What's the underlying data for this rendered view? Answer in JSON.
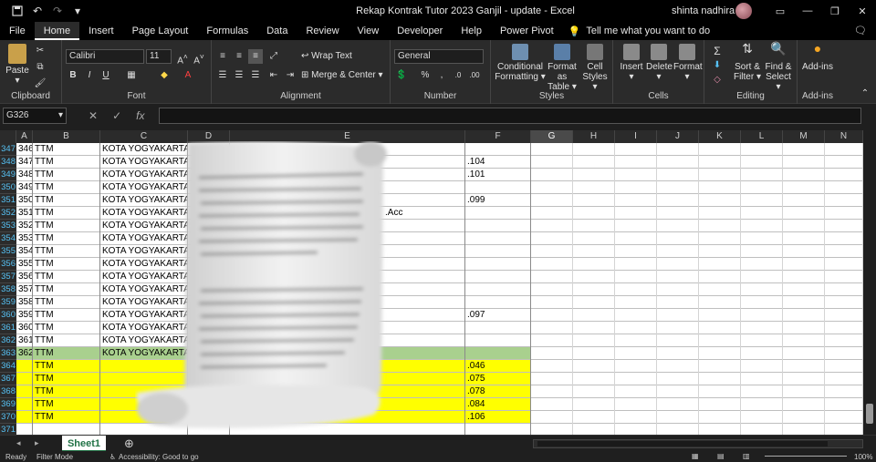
{
  "window": {
    "title": "Rekap Kontrak Tutor 2023 Ganjil - update  -  Excel",
    "user": "shinta nadhira"
  },
  "tabs": [
    "File",
    "Home",
    "Insert",
    "Page Layout",
    "Formulas",
    "Data",
    "Review",
    "View",
    "Developer",
    "Help",
    "Power Pivot"
  ],
  "tellme": "Tell me what you want to do",
  "ribbon": {
    "paste": "Paste",
    "font_name": "Calibri",
    "font_size": "11",
    "wrap_text": "Wrap Text",
    "merge_center": "Merge & Center",
    "number_format": "General",
    "conditional": "Conditional",
    "formatting": "Formatting",
    "format_as": "Format as",
    "table": "Table",
    "cell": "Cell",
    "styles_btn": "Styles",
    "insert": "Insert",
    "delete": "Delete",
    "format": "Format",
    "sort_filter": "Sort &",
    "filter": "Filter",
    "find_select": "Find &",
    "select": "Select",
    "addins": "Add-ins",
    "groups": {
      "clipboard": "Clipboard",
      "font": "Font",
      "alignment": "Alignment",
      "number": "Number",
      "styles": "Styles",
      "cells": "Cells",
      "editing": "Editing",
      "addins": "Add-ins"
    }
  },
  "formula_bar": {
    "name_box": "G326",
    "formula": ""
  },
  "columns": [
    "A",
    "B",
    "C",
    "D",
    "E",
    "F",
    "G",
    "H",
    "I",
    "J",
    "K",
    "L",
    "M",
    "N"
  ],
  "selected_column": "G",
  "rows": [
    {
      "row": "347",
      "a": "346",
      "b": "TTM",
      "c": "KOTA YOGYAKARTA",
      "e": "",
      "f": "",
      "style": "plain"
    },
    {
      "row": "348",
      "a": "347",
      "b": "TTM",
      "c": "KOTA YOGYAKARTA",
      "e": "",
      "f": ".104",
      "style": "plain"
    },
    {
      "row": "349",
      "a": "348",
      "b": "TTM",
      "c": "KOTA YOGYAKARTA",
      "e": "",
      "f": ".101",
      "style": "plain"
    },
    {
      "row": "350",
      "a": "349",
      "b": "TTM",
      "c": "KOTA YOGYAKARTA",
      "e": "",
      "f": "",
      "style": "plain"
    },
    {
      "row": "351",
      "a": "350",
      "b": "TTM",
      "c": "KOTA YOGYAKARTA",
      "e": "",
      "f": ".099",
      "style": "plain"
    },
    {
      "row": "352",
      "a": "351",
      "b": "TTM",
      "c": "KOTA YOGYAKARTA",
      "e": ".Acc",
      "f": "",
      "style": "plain"
    },
    {
      "row": "353",
      "a": "352",
      "b": "TTM",
      "c": "KOTA YOGYAKARTA",
      "e": "",
      "f": "",
      "style": "plain"
    },
    {
      "row": "354",
      "a": "353",
      "b": "TTM",
      "c": "KOTA YOGYAKARTA",
      "e": "",
      "f": "",
      "style": "plain"
    },
    {
      "row": "355",
      "a": "354",
      "b": "TTM",
      "c": "KOTA YOGYAKARTA",
      "e": "",
      "f": "",
      "style": "plain"
    },
    {
      "row": "356",
      "a": "355",
      "b": "TTM",
      "c": "KOTA YOGYAKARTA",
      "e": "",
      "f": "",
      "style": "plain"
    },
    {
      "row": "357",
      "a": "356",
      "b": "TTM",
      "c": "KOTA YOGYAKARTA",
      "e": "",
      "f": "",
      "style": "plain"
    },
    {
      "row": "358",
      "a": "357",
      "b": "TTM",
      "c": "KOTA YOGYAKARTA",
      "e": "",
      "f": "",
      "style": "plain"
    },
    {
      "row": "359",
      "a": "358",
      "b": "TTM",
      "c": "KOTA YOGYAKARTA",
      "e": "",
      "f": "",
      "style": "plain"
    },
    {
      "row": "360",
      "a": "359",
      "b": "TTM",
      "c": "KOTA YOGYAKARTA",
      "e": "",
      "f": ".097",
      "style": "plain"
    },
    {
      "row": "361",
      "a": "360",
      "b": "TTM",
      "c": "KOTA YOGYAKARTA",
      "e": "",
      "f": "",
      "style": "plain"
    },
    {
      "row": "362",
      "a": "361",
      "b": "TTM",
      "c": "KOTA YOGYAKARTA",
      "e": "",
      "f": "",
      "style": "plain"
    },
    {
      "row": "363",
      "a": "362",
      "b": "TTM",
      "c": "KOTA YOGYAKARTA",
      "e": "",
      "f": "",
      "style": "green"
    },
    {
      "row": "364",
      "a": "",
      "b": "TTM",
      "c": "",
      "e": "",
      "f": ".046",
      "style": "yellow"
    },
    {
      "row": "367",
      "a": "",
      "b": "TTM",
      "c": "",
      "e": "",
      "f": ".075",
      "style": "yellow"
    },
    {
      "row": "368",
      "a": "",
      "b": "TTM",
      "c": "",
      "e": "",
      "f": ".078",
      "style": "yellow"
    },
    {
      "row": "369",
      "a": "",
      "b": "TTM",
      "c": "",
      "e": "",
      "f": ".084",
      "style": "yellow"
    },
    {
      "row": "370",
      "a": "",
      "b": "TTM",
      "c": "",
      "e": "",
      "f": ".106",
      "style": "yellow"
    },
    {
      "row": "371",
      "a": "",
      "b": "",
      "c": "",
      "e": "",
      "f": "",
      "style": "empty"
    }
  ],
  "colors": {
    "green_row": "#a9d08e",
    "yellow_row": "#ffff00",
    "excel_green": "#217346",
    "row_header_text": "#56c0f2"
  },
  "sheet": {
    "active": "Sheet1"
  },
  "status": {
    "ready": "Ready",
    "filter_mode": "Filter Mode",
    "accessibility": "Accessibility: Good to go",
    "zoom": "100%"
  }
}
